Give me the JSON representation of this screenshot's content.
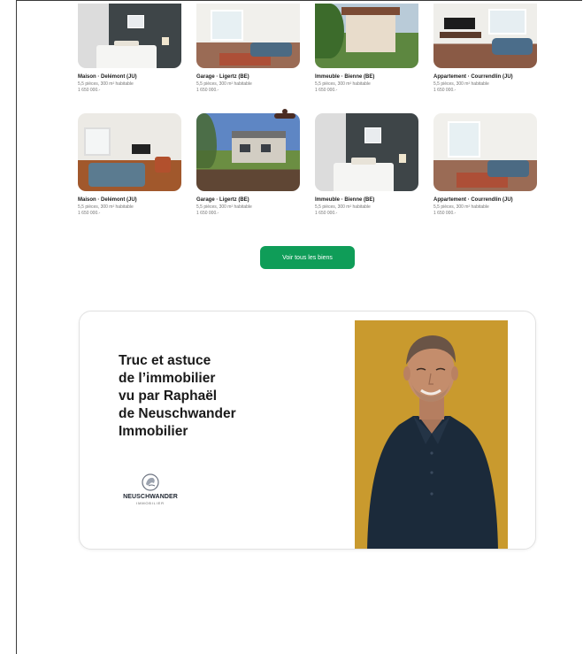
{
  "listings": {
    "row1": [
      {
        "title": "Maison · Delémont (JU)",
        "details": "5,5 pièces, 300 m² habitable",
        "price": "1 650 000.-",
        "image": "bedroom-photo"
      },
      {
        "title": "Garage · Ligertz (BE)",
        "details": "5,5 pièces, 300 m² habitable",
        "price": "1 650 000.-",
        "image": "living-room-photo"
      },
      {
        "title": "Immeuble · Bienne (BE)",
        "details": "5,5 pièces, 300 m² habitable",
        "price": "1 650 000.-",
        "image": "house-exterior-photo"
      },
      {
        "title": "Appartement · Courrendlin (JU)",
        "details": "5,5 pièces, 300 m² habitable",
        "price": "1 650 000.-",
        "image": "apartment-living-photo"
      }
    ],
    "row2": [
      {
        "title": "Maison · Delémont (JU)",
        "details": "5,5 pièces, 300 m² habitable",
        "price": "1 650 000.-",
        "image": "living-room-photo"
      },
      {
        "title": "Garage · Ligertz (BE)",
        "details": "5,5 pièces, 300 m² habitable",
        "price": "1 650 000.-",
        "image": "building-exterior-photo"
      },
      {
        "title": "Immeuble · Bienne (BE)",
        "details": "5,5 pièces, 300 m² habitable",
        "price": "1 650 000.-",
        "image": "bedroom-photo"
      },
      {
        "title": "Appartement · Courrendlin (JU)",
        "details": "5,5 pièces, 300 m² habitable",
        "price": "1 650 000.-",
        "image": "living-room-photo"
      }
    ]
  },
  "cta": {
    "label": "Voir tous les biens",
    "color": "#0f9d58"
  },
  "promo": {
    "heading": "Truc et astuce\nde l’immobilier\nvu par Raphaël\nde Neuschwander\nImmobilier",
    "logo_name": "NEUSCHWANDER",
    "logo_tagline": "IMMOBILIER",
    "portrait_bg": "#c99a2e"
  }
}
